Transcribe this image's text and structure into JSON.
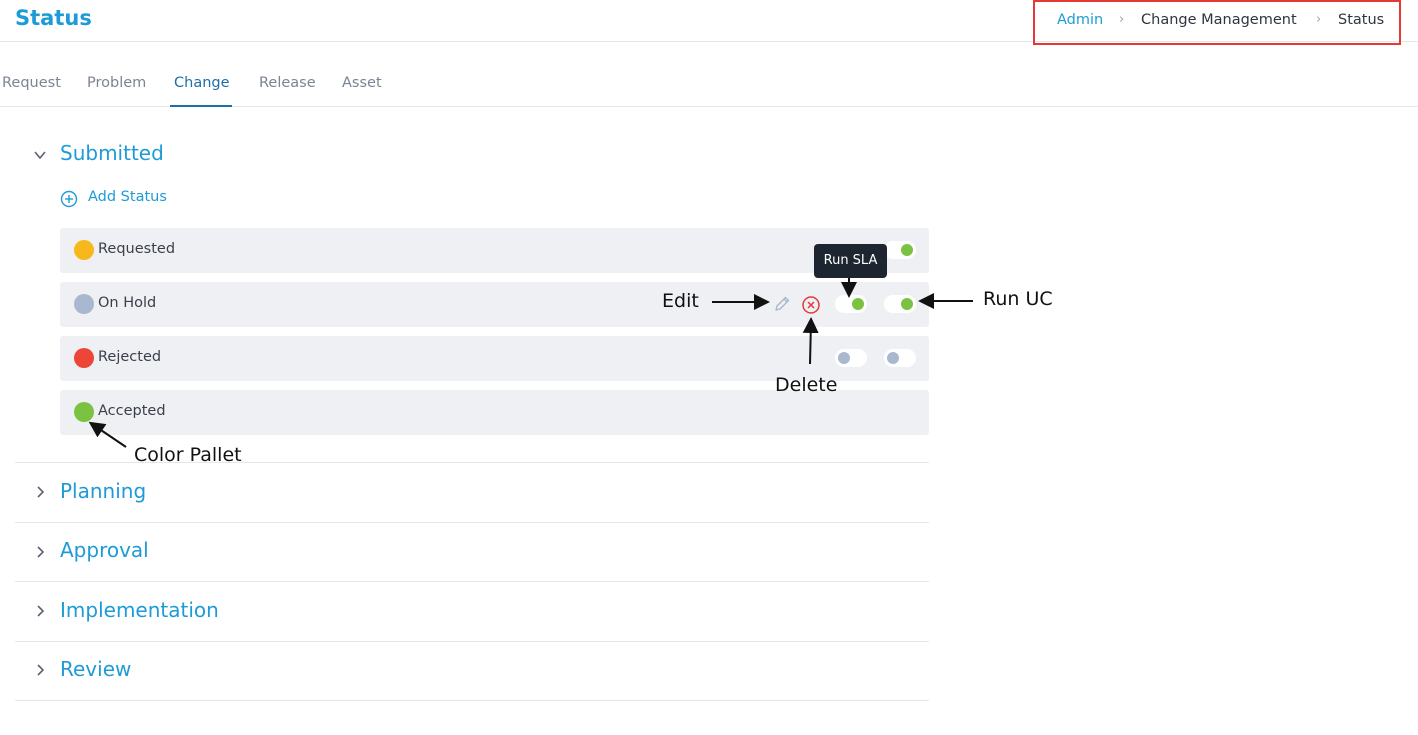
{
  "page": {
    "title": "Status"
  },
  "breadcrumb": {
    "items": [
      "Admin",
      "Change Management",
      "Status"
    ]
  },
  "tabs": [
    {
      "label": "Request",
      "active": false
    },
    {
      "label": "Problem",
      "active": false
    },
    {
      "label": "Change",
      "active": true
    },
    {
      "label": "Release",
      "active": false
    },
    {
      "label": "Asset",
      "active": false
    }
  ],
  "sections": {
    "submitted": {
      "title": "Submitted",
      "expanded": true,
      "add_label": "Add Status",
      "statuses": [
        {
          "name": "Requested",
          "color": "#f6b81a",
          "run_sla": null,
          "run_uc": true
        },
        {
          "name": "On Hold",
          "color": "#a9b8cf",
          "run_sla": true,
          "run_uc": true
        },
        {
          "name": "Rejected",
          "color": "#ee4539",
          "run_sla": false,
          "run_uc": false
        },
        {
          "name": "Accepted",
          "color": "#7cc242",
          "run_sla": null,
          "run_uc": null
        }
      ]
    },
    "planning": {
      "title": "Planning",
      "expanded": false
    },
    "approval": {
      "title": "Approval",
      "expanded": false
    },
    "implementation": {
      "title": "Implementation",
      "expanded": false
    },
    "review": {
      "title": "Review",
      "expanded": false
    }
  },
  "tooltip": {
    "text": "Run SLA"
  },
  "annotations": {
    "edit": "Edit",
    "delete": "Delete",
    "run_uc": "Run UC",
    "color_pallet": "Color Pallet"
  },
  "colors": {
    "brand": "#1e9bd7",
    "active_tab": "#1e6fa8",
    "toggle_on": "#7cc242",
    "toggle_off": "#a9b8cf",
    "delete": "#e53935",
    "highlight_border": "#e53935"
  }
}
